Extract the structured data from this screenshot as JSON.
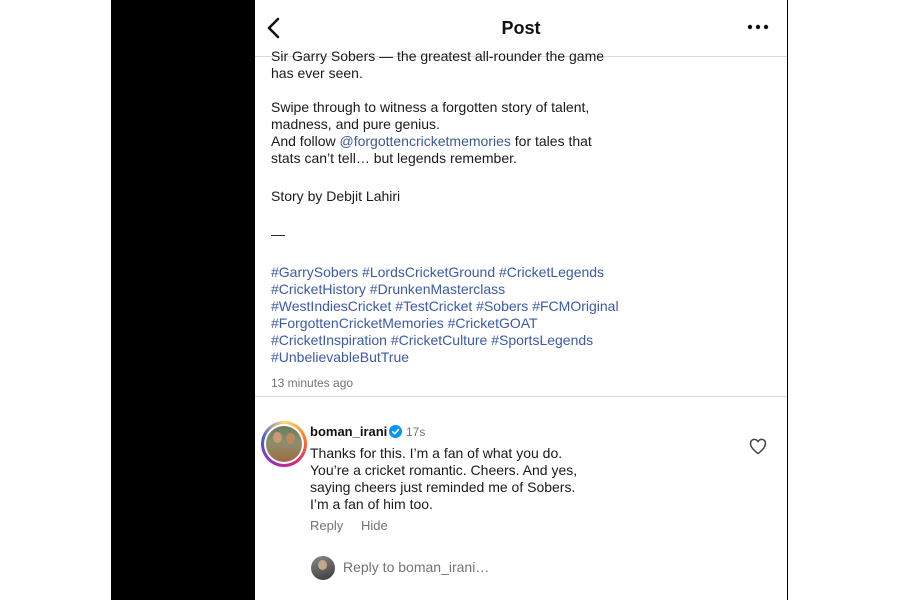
{
  "header": {
    "title": "Post"
  },
  "caption": {
    "line1": "Sir Garry Sobers — the greatest all-rounder the game",
    "line2": "has ever seen.",
    "line3": "Swipe through to witness a forgotten story of talent,",
    "line4": "madness, and pure genius.",
    "line5_pre": "And follow ",
    "mention": "@forgottencricketmemories",
    "line5_post": " for tales that",
    "line6": "stats can’t tell… but legends remember.",
    "credit": "Story by Debjit Lahiri",
    "dash": "—",
    "hashtags": [
      [
        "#GarrySobers",
        "#LordsCricketGround",
        "#CricketLegends"
      ],
      [
        "#CricketHistory",
        "#DrunkenMasterclass"
      ],
      [
        "#WestIndiesCricket",
        "#TestCricket",
        "#Sobers",
        "#FCMOriginal"
      ],
      [
        "#ForgottenCricketMemories",
        "#CricketGOAT"
      ],
      [
        "#CricketInspiration",
        "#CricketCulture",
        "#SportsLegends"
      ],
      [
        "#UnbelievableButTrue"
      ]
    ],
    "timestamp": "13 minutes ago"
  },
  "comment": {
    "username": "boman_irani",
    "time": "17s",
    "lines": [
      "Thanks for this. I’m a fan of what you do.",
      "You’re a cricket romantic.  Cheers. And yes,",
      "saying cheers just reminded me of Sobers.",
      "I’m a fan of him too."
    ],
    "reply_label": "Reply",
    "hide_label": "Hide"
  },
  "reply_box": {
    "prefix": "Reply to ",
    "target": "boman_irani…"
  },
  "colors": {
    "link": "#3b5aa8",
    "muted": "#737373",
    "verified": "#0095f6"
  }
}
